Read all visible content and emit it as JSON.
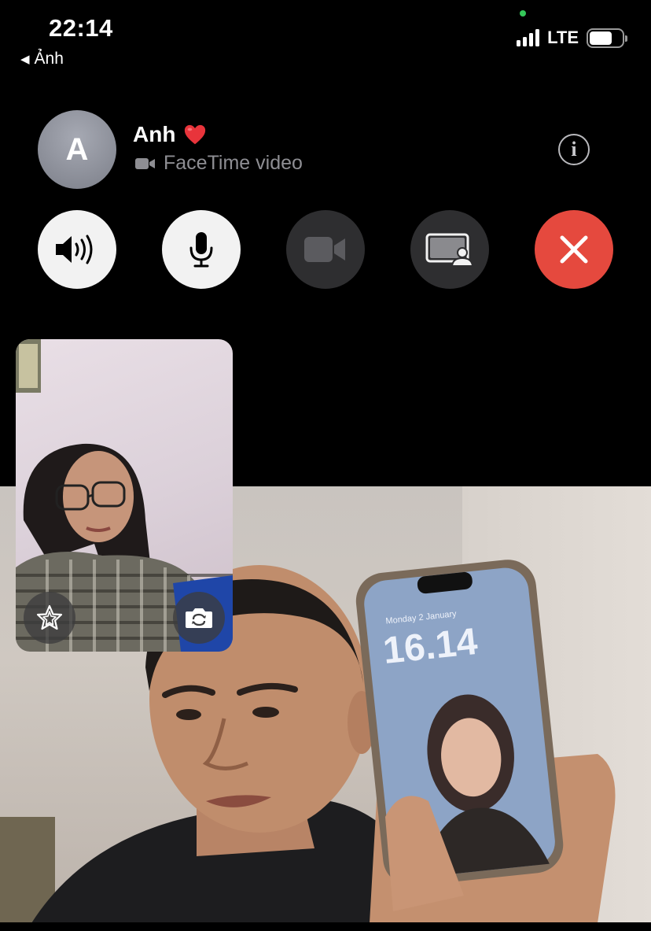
{
  "status_bar": {
    "time": "22:14",
    "back_label": "Ảnh",
    "network": "LTE",
    "signal_icon": "cellular-signal-icon",
    "battery_icon": "battery-icon"
  },
  "call": {
    "avatar_initial": "A",
    "caller_name": "Anh",
    "heart_icon": "red-heart-emoji",
    "call_type": "FaceTime video",
    "call_type_icon": "video-camera-icon",
    "info_icon": "info-icon"
  },
  "controls": [
    {
      "name": "speaker-button",
      "icon": "speaker-icon",
      "state": "on"
    },
    {
      "name": "mute-button",
      "icon": "microphone-icon",
      "state": "on"
    },
    {
      "name": "camera-button",
      "icon": "video-camera-icon",
      "state": "off"
    },
    {
      "name": "share-screen-button",
      "icon": "shareplay-icon",
      "state": "off"
    },
    {
      "name": "end-call-button",
      "icon": "close-icon",
      "state": "active"
    }
  ],
  "self_view": {
    "effects_icon": "effects-star-icon",
    "flip_icon": "flip-camera-icon"
  },
  "colors": {
    "background": "#000000",
    "end_call": "#e5493e",
    "active_control": "#f2f2f2",
    "inactive_control": "#2e2e30",
    "secondary_text": "#8e8e93"
  }
}
